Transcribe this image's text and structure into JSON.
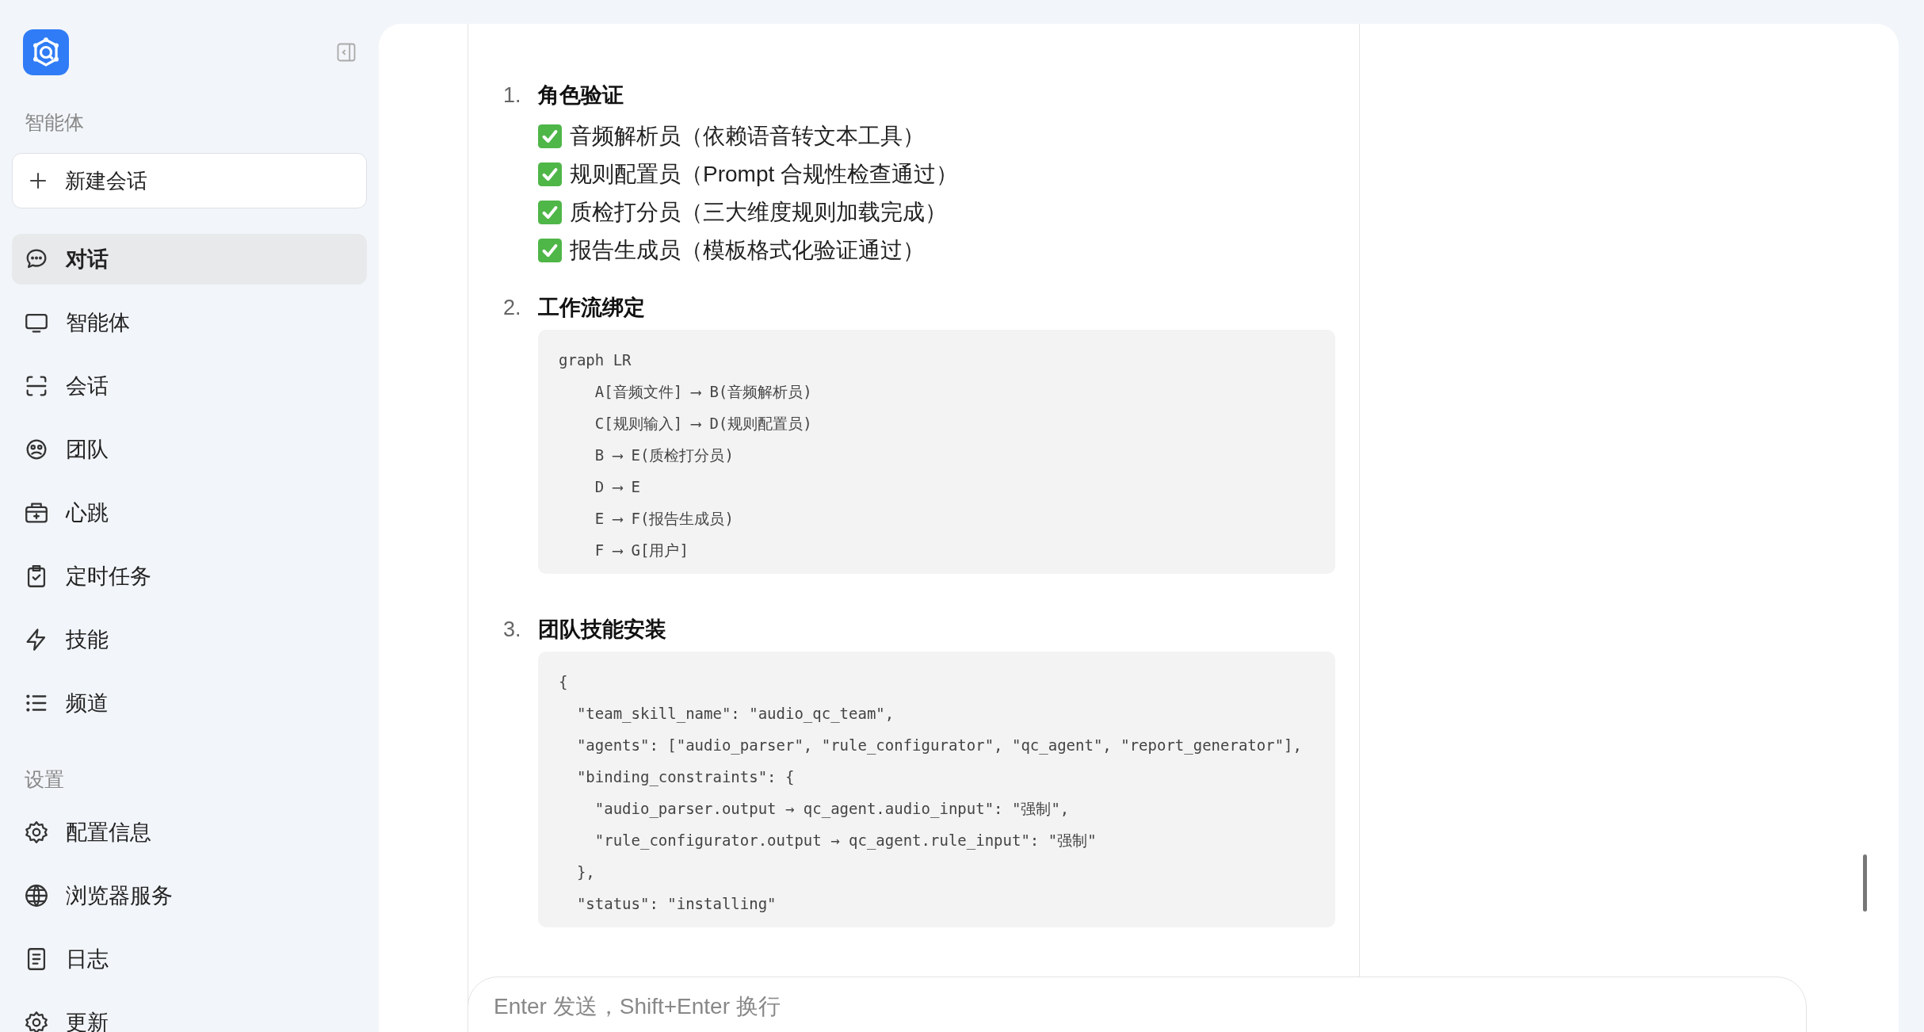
{
  "sidebar": {
    "section_agents": "智能体",
    "new_chat_button": "新建会话",
    "nav_items": [
      {
        "label": "对话",
        "selected": true
      },
      {
        "label": "智能体",
        "selected": false
      },
      {
        "label": "会话",
        "selected": false
      },
      {
        "label": "团队",
        "selected": false
      },
      {
        "label": "心跳",
        "selected": false
      },
      {
        "label": "定时任务",
        "selected": false
      },
      {
        "label": "技能",
        "selected": false
      },
      {
        "label": "频道",
        "selected": false
      }
    ],
    "section_settings": "设置",
    "settings_items": [
      {
        "label": "配置信息",
        "selected": false
      },
      {
        "label": "浏览器服务",
        "selected": false
      },
      {
        "label": "日志",
        "selected": false
      },
      {
        "label": "更新",
        "selected": false
      }
    ]
  },
  "message": {
    "steps": [
      {
        "number": "1.",
        "title": "角色验证",
        "checks": [
          {
            "text": "音频解析员（依赖语音转文本工具）",
            "checked": true
          },
          {
            "text": "规则配置员（Prompt 合规性检查通过）",
            "checked": true
          },
          {
            "text": "质检打分员（三大维度规则加载完成）",
            "checked": true
          },
          {
            "text": "报告生成员（模板格式化验证通过）",
            "checked": true
          }
        ]
      },
      {
        "number": "2.",
        "title": "工作流绑定",
        "code": [
          "graph LR",
          "    A[音频文件] ⟶ B(音频解析员)",
          "    C[规则输入] ⟶ D(规则配置员)",
          "    B ⟶ E(质检打分员)",
          "    D ⟶ E",
          "    E ⟶ F(报告生成员)",
          "    F ⟶ G[用户]"
        ]
      },
      {
        "number": "3.",
        "title": "团队技能安装",
        "code": [
          "{",
          "  \"team_skill_name\": \"audio_qc_team\",",
          "  \"agents\": [\"audio_parser\", \"rule_configurator\", \"qc_agent\", \"report_generator\"],",
          "  \"binding_constraints\": {",
          "    \"audio_parser.output → qc_agent.audio_input\": \"强制\",",
          "    \"rule_configurator.output → qc_agent.rule_input\": \"强制\"",
          "  },",
          "  \"status\": \"installing\""
        ]
      }
    ]
  },
  "composer": {
    "placeholder": "Enter 发送，Shift+Enter 换行"
  }
}
